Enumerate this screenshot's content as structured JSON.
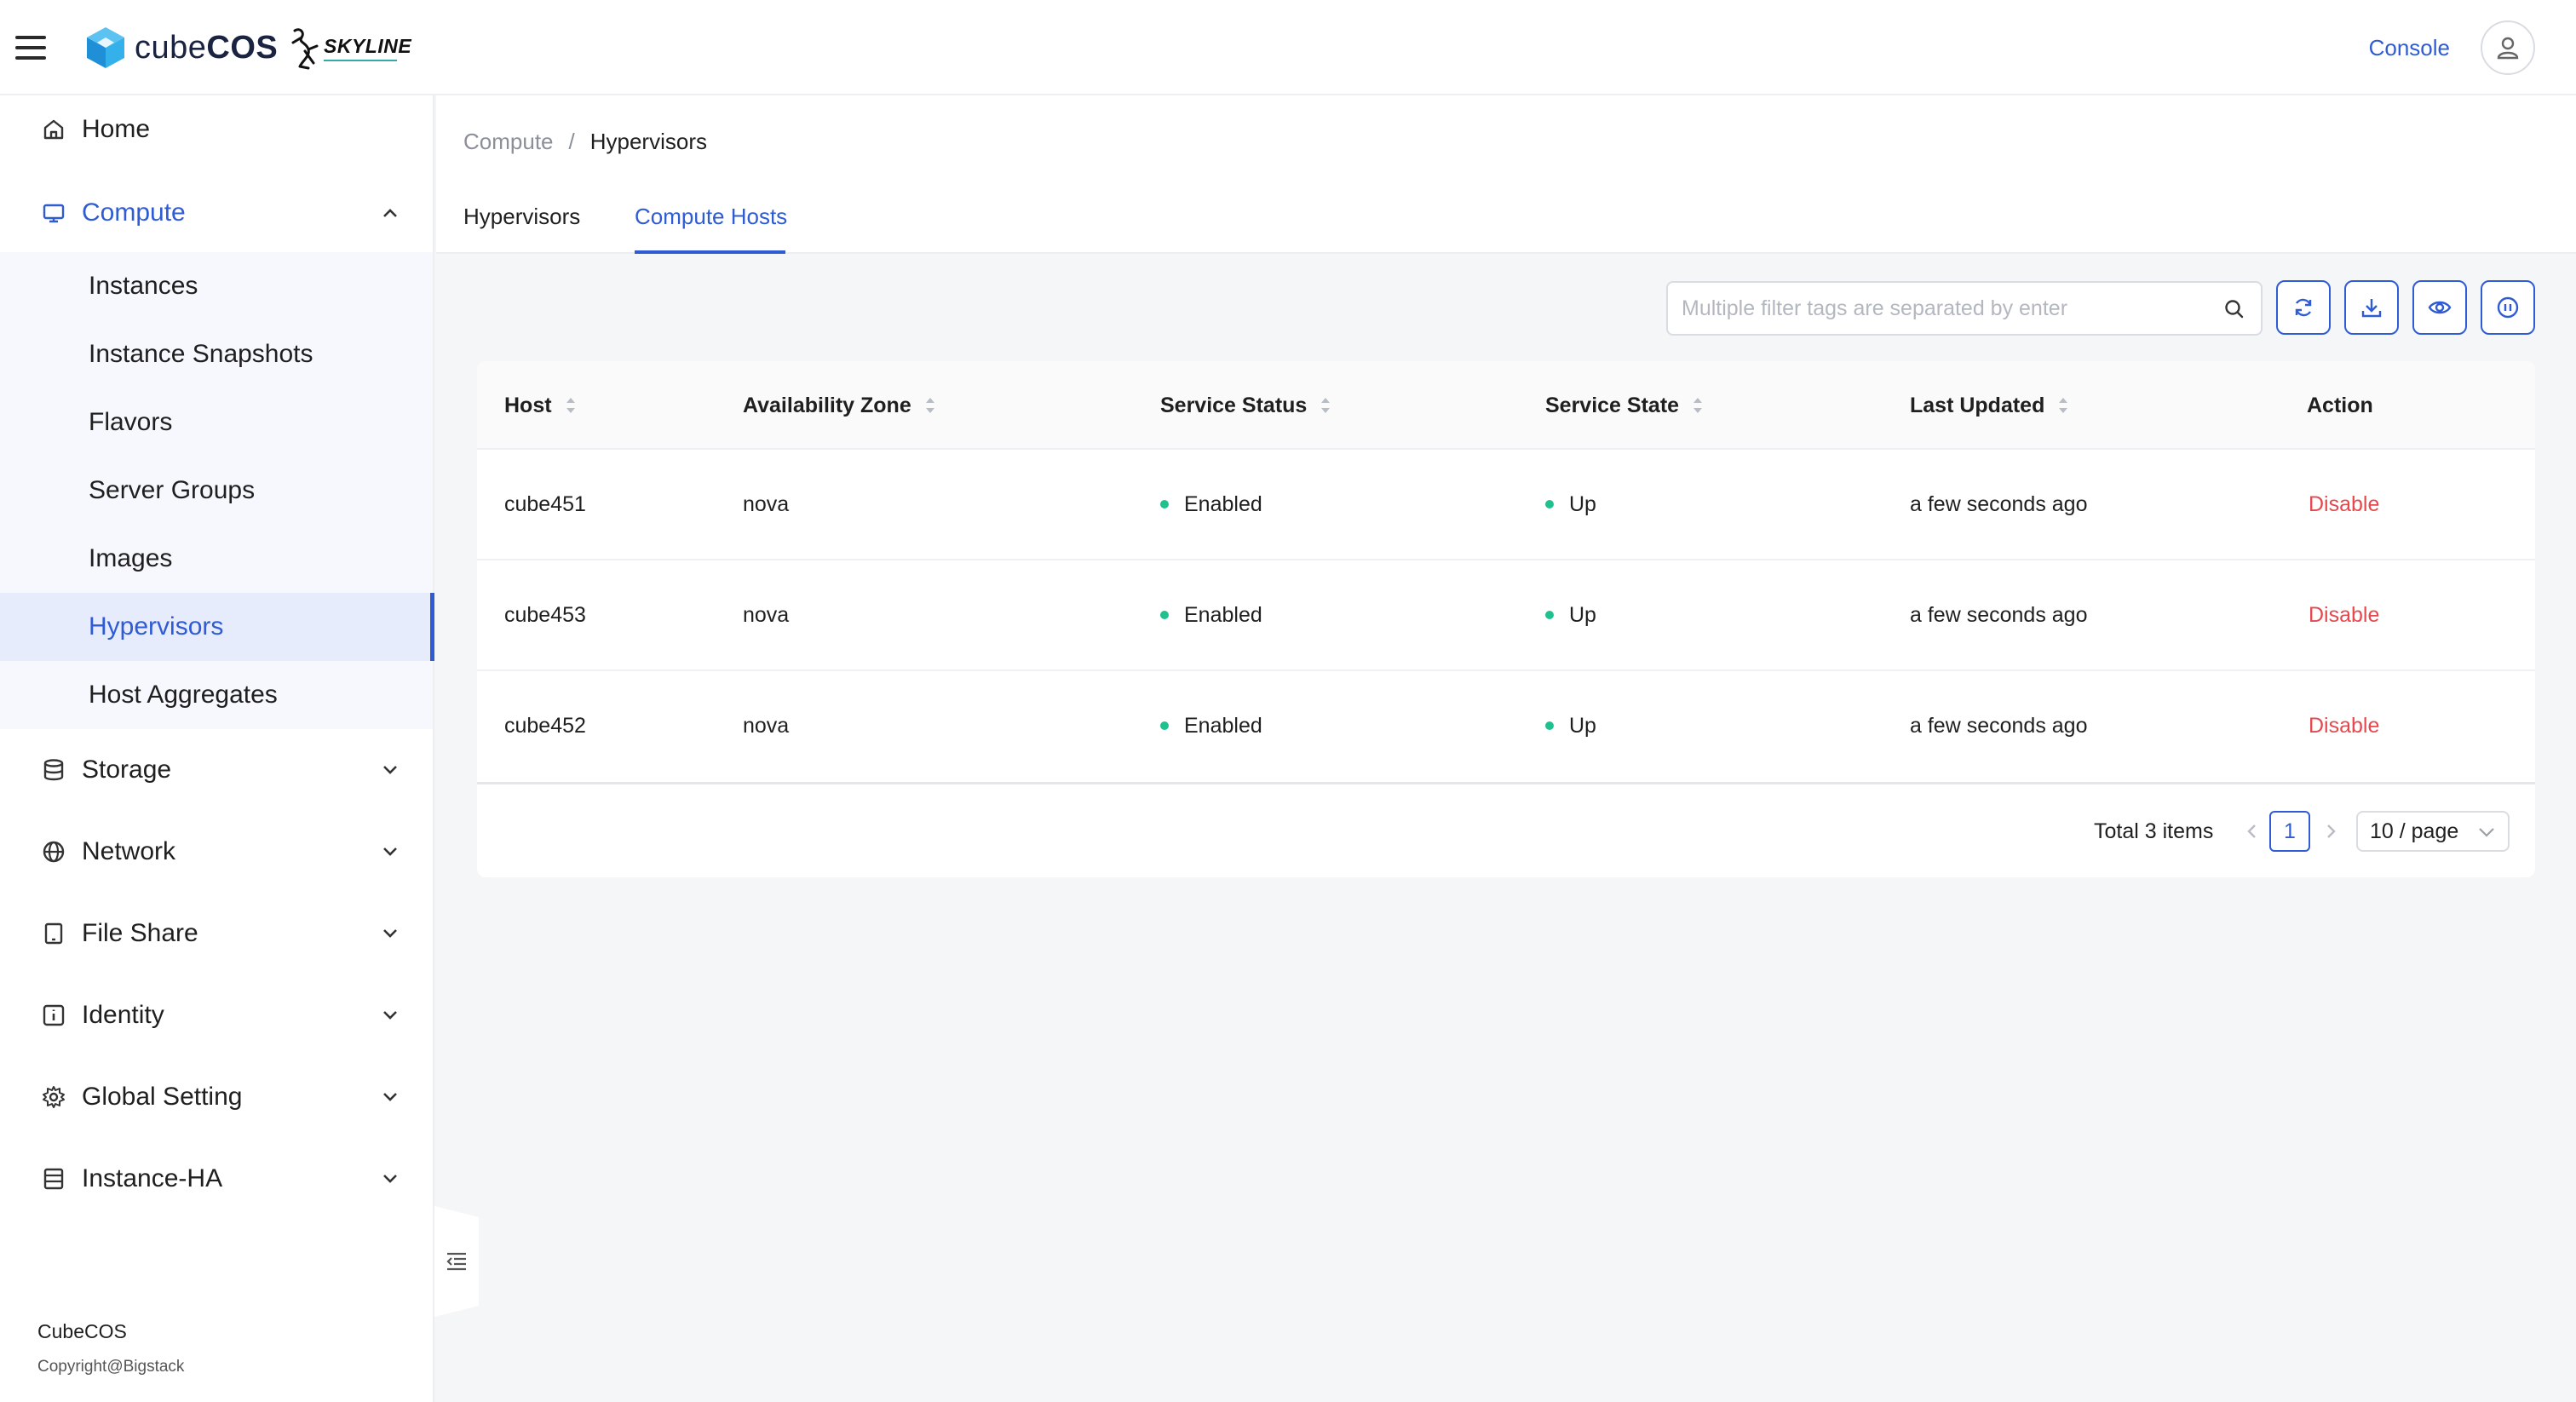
{
  "header": {
    "logo_text_light": "cube",
    "logo_text_bold": "COS",
    "skyline_text": "SKYLINE",
    "console_label": "Console"
  },
  "sidebar": {
    "items": [
      {
        "label": "Home",
        "icon": "home-icon"
      },
      {
        "label": "Compute",
        "icon": "monitor-icon",
        "expanded": true
      },
      {
        "label": "Storage",
        "icon": "database-icon"
      },
      {
        "label": "Network",
        "icon": "globe-icon"
      },
      {
        "label": "File Share",
        "icon": "tablet-icon"
      },
      {
        "label": "Identity",
        "icon": "info-icon"
      },
      {
        "label": "Global Setting",
        "icon": "gear-icon"
      },
      {
        "label": "Instance-HA",
        "icon": "server-icon"
      }
    ],
    "compute_children": [
      "Instances",
      "Instance Snapshots",
      "Flavors",
      "Server Groups",
      "Images",
      "Hypervisors",
      "Host Aggregates"
    ],
    "selected": "Hypervisors",
    "footer_brand": "CubeCOS",
    "footer_copyright": "Copyright@Bigstack"
  },
  "breadcrumb": {
    "parent": "Compute",
    "separator": "/",
    "current": "Hypervisors"
  },
  "tabs": [
    {
      "label": "Hypervisors",
      "active": false
    },
    {
      "label": "Compute Hosts",
      "active": true
    }
  ],
  "search": {
    "placeholder": "Multiple filter tags are separated by enter",
    "value": ""
  },
  "toolbar": {
    "buttons": [
      "refresh-icon",
      "download-icon",
      "eye-icon",
      "pause-icon"
    ]
  },
  "table": {
    "columns": [
      "Host",
      "Availability Zone",
      "Service Status",
      "Service State",
      "Last Updated",
      "Action"
    ],
    "rows": [
      {
        "host": "cube451",
        "zone": "nova",
        "status": "Enabled",
        "state": "Up",
        "updated": "a few seconds ago",
        "action": "Disable"
      },
      {
        "host": "cube453",
        "zone": "nova",
        "status": "Enabled",
        "state": "Up",
        "updated": "a few seconds ago",
        "action": "Disable"
      },
      {
        "host": "cube452",
        "zone": "nova",
        "status": "Enabled",
        "state": "Up",
        "updated": "a few seconds ago",
        "action": "Disable"
      }
    ]
  },
  "pagination": {
    "total_label": "Total 3 items",
    "current_page": "1",
    "page_size_label": "10 / page"
  },
  "colors": {
    "accent": "#2f5bd3",
    "status_ok": "#1fc28f",
    "danger": "#e5484d"
  }
}
